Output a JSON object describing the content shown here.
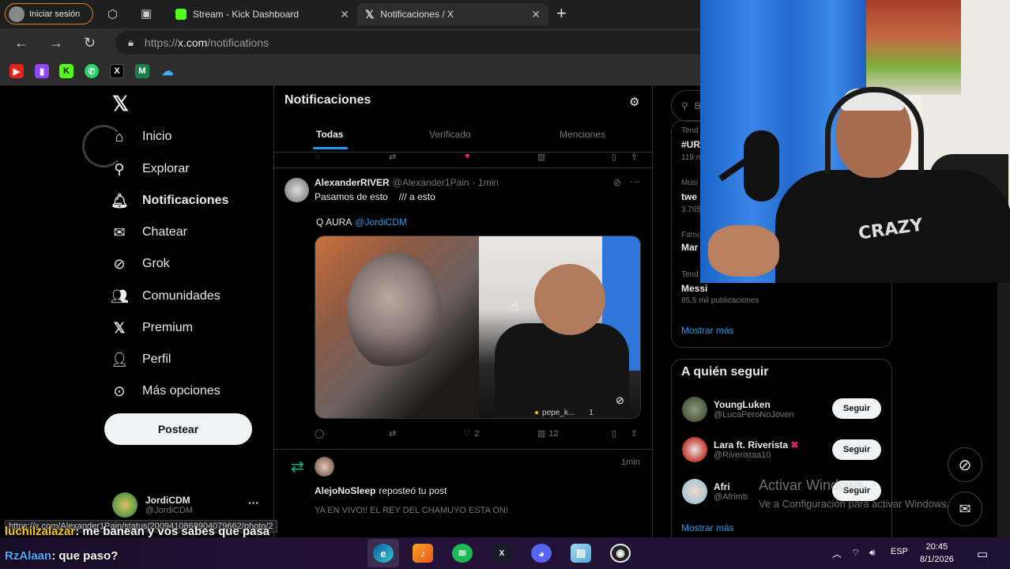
{
  "browser": {
    "profile_label": "Iniciar sesión",
    "tabs": [
      {
        "label": "Stream - Kick Dashboard",
        "icon": "kick-icon"
      },
      {
        "label": "Notificaciones / X",
        "icon": "x-logo-icon"
      }
    ],
    "url_scheme": "https://",
    "url_host": "x.com",
    "url_path": "/notifications",
    "status_url": "https://x.com/Alexander1Pain/status/2009410868904079662/photo/2"
  },
  "sidebar": {
    "items": [
      {
        "label": "Inicio",
        "icon": "home-icon"
      },
      {
        "label": "Explorar",
        "icon": "search-icon"
      },
      {
        "label": "Notificaciones",
        "icon": "bell-icon"
      },
      {
        "label": "Chatear",
        "icon": "mail-icon"
      },
      {
        "label": "Grok",
        "icon": "grok-icon"
      },
      {
        "label": "Comunidades",
        "icon": "communities-icon"
      },
      {
        "label": "Premium",
        "icon": "x-logo-icon"
      },
      {
        "label": "Perfil",
        "icon": "person-icon"
      },
      {
        "label": "Más opciones",
        "icon": "more-icon"
      }
    ],
    "post_button": "Postear",
    "account_name": "JordiCDM",
    "account_handle": "@JordiCDM"
  },
  "main": {
    "title": "Notificaciones",
    "tabs": [
      "Todas",
      "Verificado",
      "Menciones"
    ],
    "post1": {
      "author": "AlexanderRIVER",
      "handle": "@Alexander1Pain",
      "time": "· 1min",
      "line1": "Pasamos de esto",
      "line1b": "/// a esto",
      "line2": "Q AURA",
      "mention": "@JordiCDM",
      "media_tag": "pepe_k...",
      "media_tag_count": "1",
      "likes": "2",
      "views": "12"
    },
    "post2": {
      "reposter": "AlejoNoSleep",
      "repost_text": "reposteó tu post",
      "time": "1min",
      "text": "YA EN VIVO!! EL REY DEL CHAMUYO ESTA ON!"
    }
  },
  "right": {
    "search_placeholder": "Bu",
    "trends": [
      {
        "cat": "Tend",
        "title": "#UR",
        "count": "119 m"
      },
      {
        "cat": "Músi",
        "title": "twe",
        "count": "3.765"
      },
      {
        "cat": "Famo",
        "title": "Mar",
        "count": ""
      },
      {
        "cat": "Tend",
        "title": "Messi",
        "count": "65,5 mil publicaciones"
      }
    ],
    "show_more": "Mostrar más",
    "who_to_follow_title": "A quién seguir",
    "follow": [
      {
        "name": "YoungLuken",
        "handle": "@LucaPeroNoJoven"
      },
      {
        "name": "Lara ft. Riverista",
        "handle": "@Riveristaa10"
      },
      {
        "name": "Afri",
        "handle": "@Afrimb"
      }
    ],
    "follow_button": "Seguir",
    "show_more_2": "Mostrar más"
  },
  "webcam": {
    "shirt_print": "CRAZY"
  },
  "overlay": {
    "activate_title": "Activar Windows",
    "activate_sub": "Ve a Configuración para activar Windows.",
    "chat": [
      {
        "user": "luchilzalazar",
        "message": ": me banean y vos sabes que pasa"
      },
      {
        "user": "RzAlaan",
        "message": ": que paso?"
      }
    ]
  },
  "taskbar": {
    "lang": "ESP",
    "time": "20:45",
    "date": "8/1/2026"
  },
  "colors": {
    "accent": "#1d9bf0",
    "background": "#000000",
    "border": "#2f3336",
    "kick_green": "#53fc18"
  }
}
